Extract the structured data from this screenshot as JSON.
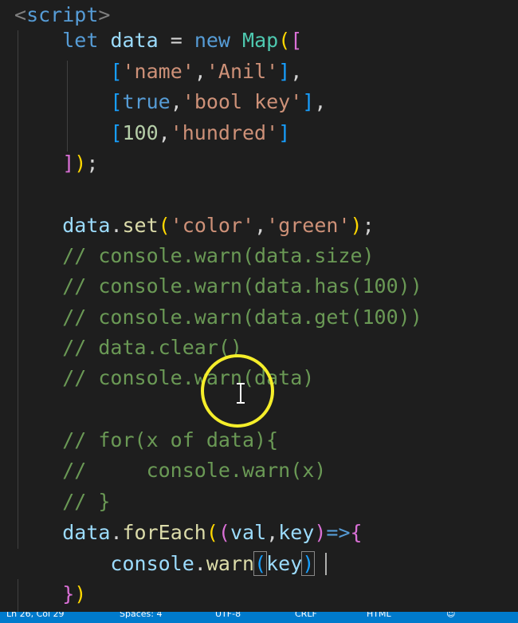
{
  "colors": {
    "background": "#1e1e1e",
    "keyword": "#569cd6",
    "variable": "#9cdcfe",
    "function": "#dcdcaa",
    "class": "#4ec9b0",
    "string": "#ce9178",
    "number": "#b5cea8",
    "comment": "#6a9955",
    "statusbar": "#007acc",
    "cursor_ring": "#f5ee2a"
  },
  "code": {
    "l1": {
      "open": "<",
      "tag": "script",
      "close": ">"
    },
    "l2": {
      "let": "let",
      "data": "data",
      "eq": " = ",
      "new": "new",
      "map": "Map",
      "p": "(",
      "b": "["
    },
    "l3": {
      "b1": "[",
      "s1": "'name'",
      "c": ",",
      "s2": "'Anil'",
      "b2": "]",
      "tail": ","
    },
    "l4": {
      "b1": "[",
      "kw": "true",
      "c": ",",
      "s": "'bool key'",
      "b2": "]",
      "tail": ","
    },
    "l5": {
      "b1": "[",
      "n": "100",
      "c": ",",
      "s": "'hundred'",
      "b2": "]"
    },
    "l6": {
      "b": "]",
      "p": ")",
      "semi": ";"
    },
    "l8": {
      "obj": "data",
      "dot": ".",
      "fn": "set",
      "p1": "(",
      "s1": "'color'",
      "c": ",",
      "s2": "'green'",
      "p2": ")",
      "semi": ";"
    },
    "l9": "// console.warn(data.size)",
    "l10": "// console.warn(data.has(100))",
    "l11": "// console.warn(data.get(100))",
    "l12": "// data.clear()",
    "l13": "// console.warn(data)",
    "l15": "// for(x of data){",
    "l16": "//     console.warn(x)",
    "l17": "// }",
    "l18": {
      "obj": "data",
      "dot": ".",
      "fn": "forEach",
      "p1": "(",
      "p2": "(",
      "a1": "val",
      "c": ",",
      "a2": "key",
      "p3": ")",
      "arrow": "=>",
      "brace": "{"
    },
    "l19": {
      "obj": "console",
      "dot": ".",
      "fn": "warn",
      "p1": "(",
      "arg": "key",
      "p2": ")"
    },
    "l20": {
      "brace": "}",
      "p": ")"
    }
  },
  "statusbar": {
    "a": "Ln 26, Col 29",
    "b": "Spaces: 4",
    "c": "UTF-8",
    "d": "CRLF",
    "e": "HTML"
  }
}
